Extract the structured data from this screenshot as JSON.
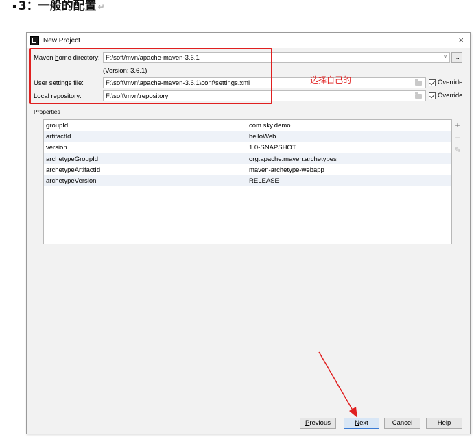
{
  "doc": {
    "heading_bullet": "▪",
    "heading": "3：一般的配置",
    "heading_mark": "↵"
  },
  "window": {
    "title": "New Project",
    "close": "×"
  },
  "form": {
    "maven_home": {
      "label_pre": "Maven ",
      "label_mn": "h",
      "label_post": "ome directory:",
      "value": "F:/soft/mvn/apache-maven-3.6.1",
      "arrow": "∨",
      "browse": "..."
    },
    "version_note": "(Version: 3.6.1)",
    "user_settings": {
      "label_pre": "User ",
      "label_mn": "s",
      "label_post": "ettings file:",
      "value": "F:\\soft\\mvn\\apache-maven-3.6.1\\conf\\settings.xml",
      "override": "Override"
    },
    "local_repo": {
      "label_pre": "Local ",
      "label_mn": "r",
      "label_post": "epository:",
      "value": "F:\\soft\\mvn\\repository",
      "override": "Override"
    }
  },
  "annotation": {
    "text": "选择自己的",
    "color": "#e02020"
  },
  "properties": {
    "label": "Properties",
    "rows": [
      {
        "key": "groupId",
        "value": "com.sky.demo"
      },
      {
        "key": "artifactId",
        "value": "helloWeb"
      },
      {
        "key": "version",
        "value": "1.0-SNAPSHOT"
      },
      {
        "key": "archetypeGroupId",
        "value": "org.apache.maven.archetypes"
      },
      {
        "key": "archetypeArtifactId",
        "value": "maven-archetype-webapp"
      },
      {
        "key": "archetypeVersion",
        "value": "RELEASE"
      }
    ],
    "tools": {
      "add": "+",
      "remove": "−",
      "edit": "✎"
    }
  },
  "buttons": {
    "previous": {
      "mn": "P",
      "rest": "revious"
    },
    "next": {
      "mn": "N",
      "rest": "ext"
    },
    "cancel": "Cancel",
    "help": "Help"
  },
  "colors": {
    "accent": "#3b7bd4",
    "annotation": "#e02020",
    "dialog_bg": "#f2f2f2"
  }
}
